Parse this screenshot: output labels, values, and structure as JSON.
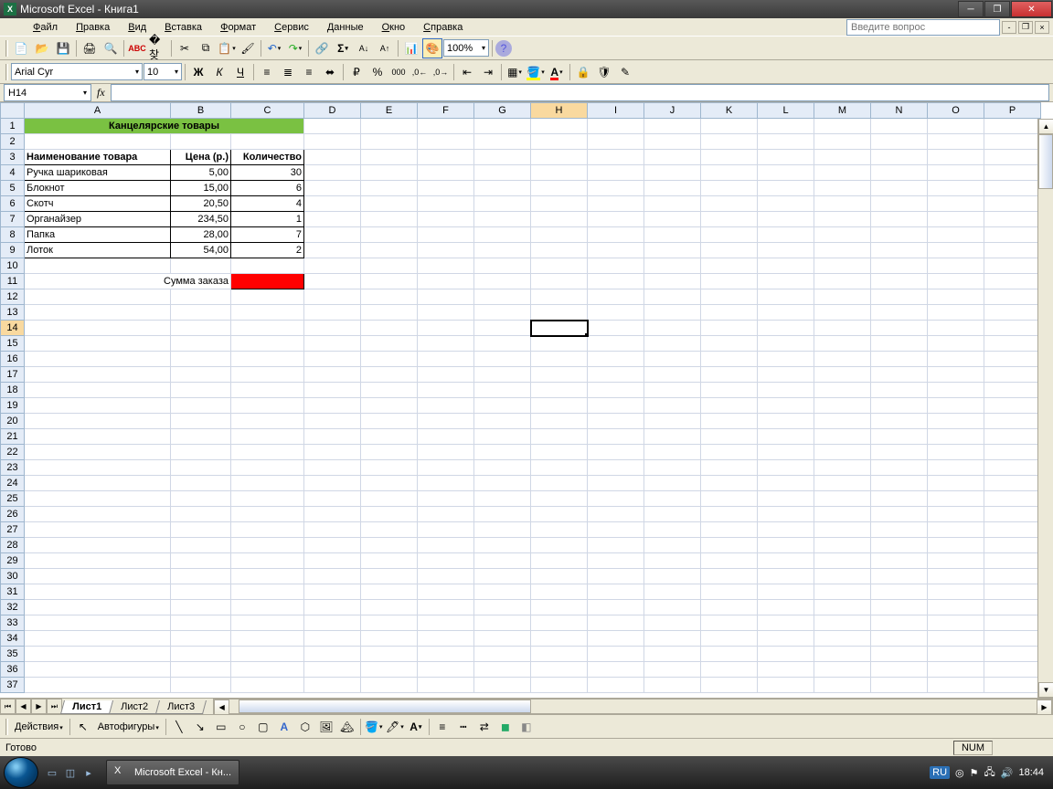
{
  "window": {
    "title": "Microsoft Excel - Книга1"
  },
  "menu": {
    "file": "Файл",
    "edit": "Правка",
    "view": "Вид",
    "insert": "Вставка",
    "format": "Формат",
    "tools": "Сервис",
    "data": "Данные",
    "window": "Окно",
    "help": "Справка"
  },
  "helpbox": {
    "placeholder": "Введите вопрос"
  },
  "font": {
    "name": "Arial Cyr",
    "size": "10"
  },
  "zoom": "100%",
  "namebox": "H14",
  "columns": [
    "A",
    "B",
    "C",
    "D",
    "E",
    "F",
    "G",
    "H",
    "I",
    "J",
    "K",
    "L",
    "M",
    "N",
    "O",
    "P"
  ],
  "active_col": "H",
  "active_row": 14,
  "sheet": {
    "title": "Канцелярские товары",
    "headers": {
      "name": "Наименование товара",
      "price": "Цена (р.)",
      "qty": "Количество"
    },
    "rows": [
      {
        "name": "Ручка шариковая",
        "price": "5,00",
        "qty": "30"
      },
      {
        "name": "Блокнот",
        "price": "15,00",
        "qty": "6"
      },
      {
        "name": "Скотч",
        "price": "20,50",
        "qty": "4"
      },
      {
        "name": "Органайзер",
        "price": "234,50",
        "qty": "1"
      },
      {
        "name": "Папка",
        "price": "28,00",
        "qty": "7"
      },
      {
        "name": "Лоток",
        "price": "54,00",
        "qty": "2"
      }
    ],
    "sum_label": "Сумма заказа"
  },
  "tabs": {
    "t1": "Лист1",
    "t2": "Лист2",
    "t3": "Лист3"
  },
  "draw": {
    "actions": "Действия",
    "autoshapes": "Автофигуры"
  },
  "status": {
    "ready": "Готово",
    "num": "NUM"
  },
  "taskbar": {
    "app": "Microsoft Excel - Кн...",
    "lang": "RU",
    "time": "18:44"
  }
}
